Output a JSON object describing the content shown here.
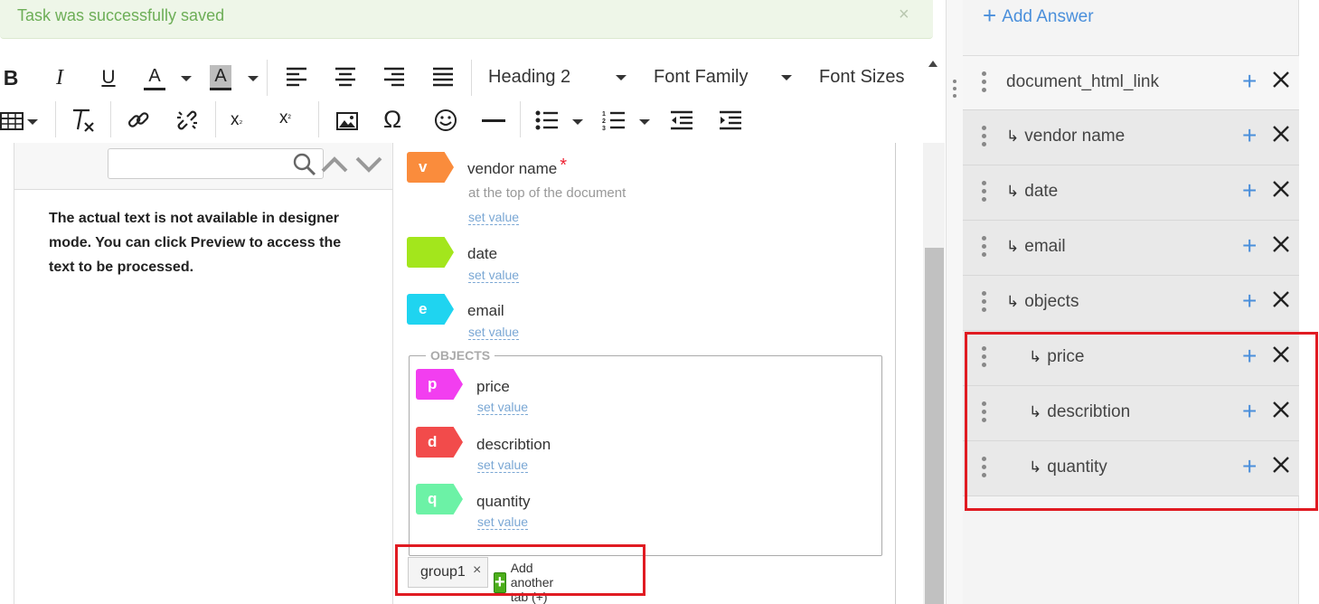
{
  "alert": {
    "text": "Task was successfully saved",
    "close": "×"
  },
  "toolbar": {
    "bold": "B",
    "italic": "I",
    "underline": "U",
    "font_color": "A",
    "bg_color": "A",
    "format_select": "Heading 2",
    "font_family": "Font Family",
    "font_sizes": "Font Sizes",
    "special_char": "Ω"
  },
  "document": {
    "search_placeholder": "",
    "info_text": "The actual text is not available in designer mode. You can click Preview to access the text to be processed."
  },
  "labels": {
    "items": [
      {
        "key": "v",
        "name": "vendor name",
        "required": "*",
        "hint": "at the top of the document",
        "set_value": "set value",
        "color": "#fa8c3c"
      },
      {
        "key": "",
        "name": "date",
        "set_value": "set value",
        "color": "#a3e61c"
      },
      {
        "key": "e",
        "name": "email",
        "set_value": "set value",
        "color": "#1fd4f0"
      }
    ],
    "objects_group": {
      "legend": "OBJECTS",
      "items": [
        {
          "key": "p",
          "name": "price",
          "set_value": "set value",
          "color": "#f23ef0"
        },
        {
          "key": "d",
          "name": "describtion",
          "set_value": "set value",
          "color": "#f24b4b"
        },
        {
          "key": "q",
          "name": "quantity",
          "set_value": "set value",
          "color": "#6cf2a6"
        }
      ]
    },
    "tabs": {
      "group1": "group1",
      "close": "×",
      "add_plus": "+",
      "add_another": "Add another tab (+)"
    }
  },
  "config": {
    "add_answer": "Add Answer",
    "add_icon": "+",
    "rows": [
      {
        "label": "document_html_link",
        "level": 0
      },
      {
        "label": "vendor name",
        "level": 1
      },
      {
        "label": "date",
        "level": 1
      },
      {
        "label": "email",
        "level": 1
      },
      {
        "label": "objects",
        "level": 1
      },
      {
        "label": "price",
        "level": 2
      },
      {
        "label": "describtion",
        "level": 2
      },
      {
        "label": "quantity",
        "level": 2
      }
    ],
    "child_arrow": "↳",
    "row_add": "+"
  },
  "colors": {
    "accent_blue": "#4a8fdb",
    "highlight_red": "#e01b22",
    "success_green": "#6dae57"
  }
}
